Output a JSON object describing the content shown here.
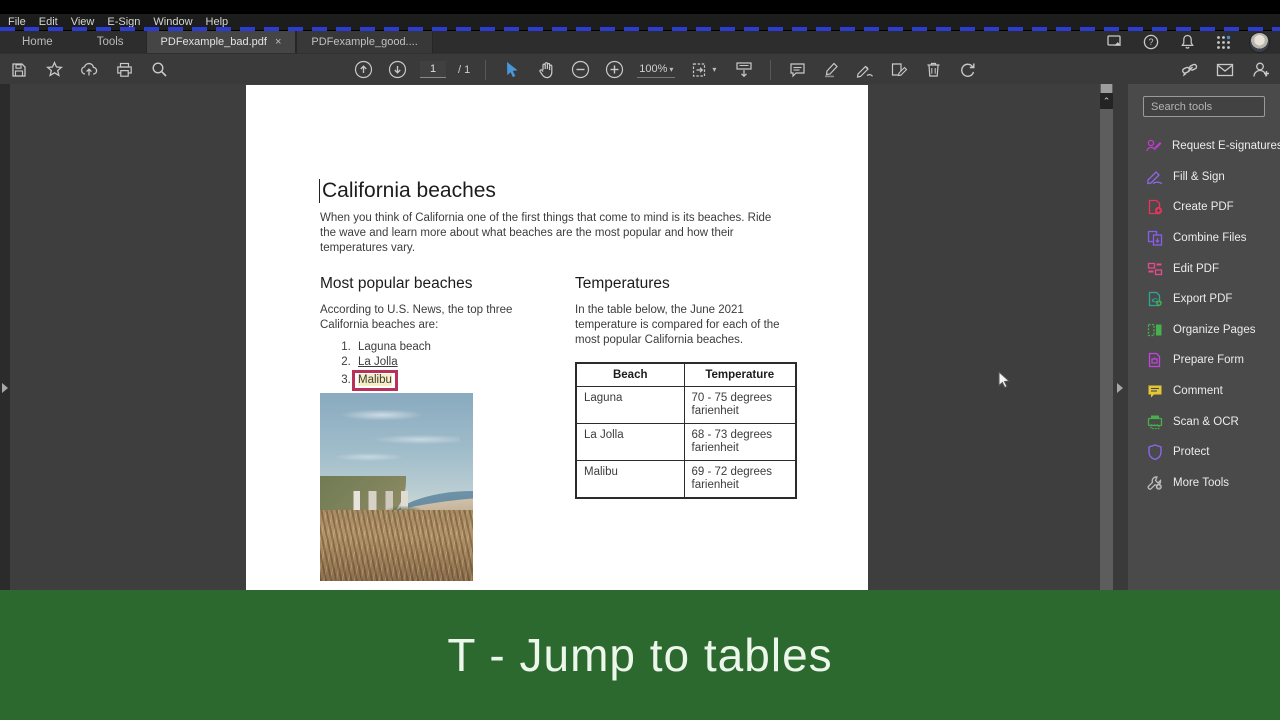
{
  "menu": {
    "items": [
      "File",
      "Edit",
      "View",
      "E-Sign",
      "Window",
      "Help"
    ]
  },
  "tabs": {
    "home": "Home",
    "tools": "Tools",
    "doc_active": "PDFexample_bad.pdf",
    "doc_active_close": "×",
    "doc_inactive": "PDFexample_good...."
  },
  "toolbar": {
    "page_current": "1",
    "page_total": "/ 1",
    "zoom_level": "100%"
  },
  "scrollbar": {
    "up_glyph": "⌃"
  },
  "tools_panel": {
    "search_placeholder": "Search tools",
    "items": [
      {
        "label": "Request E-signatures",
        "color": "#c13bd0"
      },
      {
        "label": "Fill & Sign",
        "color": "#8d67e8"
      },
      {
        "label": "Create PDF",
        "color": "#e8345e"
      },
      {
        "label": "Combine Files",
        "color": "#8a5cf0"
      },
      {
        "label": "Edit PDF",
        "color": "#e84a8a"
      },
      {
        "label": "Export PDF",
        "color": "#2ba897"
      },
      {
        "label": "Organize Pages",
        "color": "#45b04c"
      },
      {
        "label": "Prepare Form",
        "color": "#c544e0"
      },
      {
        "label": "Comment",
        "color": "#e3c735"
      },
      {
        "label": "Scan & OCR",
        "color": "#45b04c"
      },
      {
        "label": "Protect",
        "color": "#8d67e8"
      },
      {
        "label": "More Tools",
        "color": "#bdbdbd"
      }
    ]
  },
  "document": {
    "title": "California beaches",
    "intro": "When you think of California one of the first things that come to mind is its beaches. Ride the wave and learn more about what beaches are the most popular and how their temperatures vary.",
    "left": {
      "heading": "Most popular beaches",
      "text": "According to U.S. News, the top three California beaches are:",
      "list": [
        "Laguna beach",
        "La Jolla",
        "Malibu"
      ]
    },
    "right": {
      "heading": "Temperatures",
      "text": "In the table below, the June 2021 temperature is compared for each of the most popular California beaches.",
      "table": {
        "headers": [
          "Beach",
          "Temperature"
        ],
        "rows": [
          [
            "Laguna",
            "70 - 75 degrees farienheit"
          ],
          [
            "La Jolla",
            "68 - 73 degrees farienheit"
          ],
          [
            "Malibu",
            "69 - 72 degrees farienheit"
          ]
        ]
      }
    },
    "photo_alt": "coastal-beach-photo"
  },
  "banner": {
    "text": "T - Jump to tables",
    "bg": "#2c692e"
  }
}
